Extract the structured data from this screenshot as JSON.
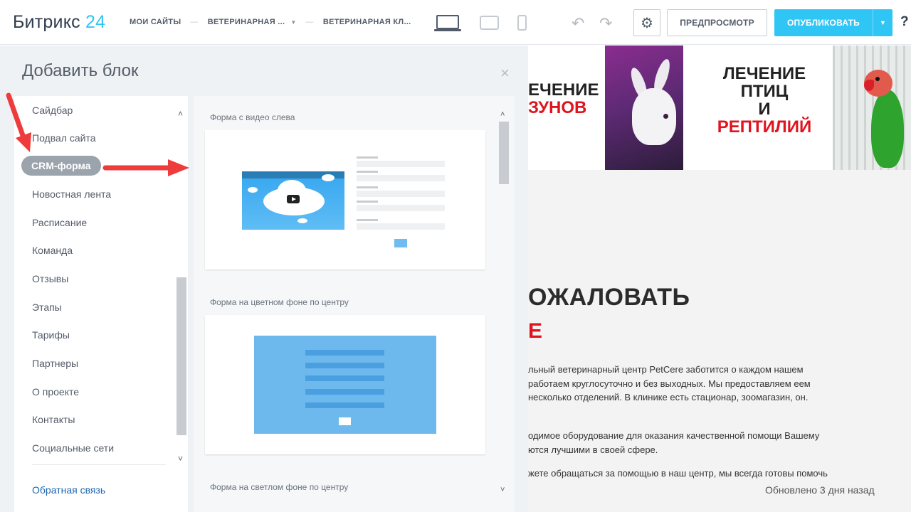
{
  "header": {
    "logo_main": "Битрикс",
    "logo_num": "24",
    "breadcrumbs": [
      "МОИ САЙТЫ",
      "ВЕТЕРИНАРНАЯ ...",
      "ВЕТЕРИНАРНАЯ КЛ..."
    ],
    "undo_icon": "↶",
    "redo_icon": "↷",
    "settings_icon": "⚙",
    "preview_label": "ПРЕДПРОСМОТР",
    "publish_label": "ОПУБЛИКОВАТЬ",
    "publish_caret": "▼",
    "help_label": "?"
  },
  "panel": {
    "title": "Добавить блок",
    "close_icon": "×",
    "menu": {
      "items": [
        "Сайдбар",
        "Подвал сайта",
        "CRM-форма",
        "Новостная лента",
        "Расписание",
        "Команда",
        "Отзывы",
        "Этапы",
        "Тарифы",
        "Партнеры",
        "О проекте",
        "Контакты",
        "Социальные сети"
      ],
      "active_index": 2,
      "feedback_link": "Обратная связь",
      "scroll_up": "˄",
      "scroll_down": "˅"
    },
    "blocks": [
      {
        "title": "Форма с видео слева"
      },
      {
        "title": "Форма на цветном фоне по центру"
      },
      {
        "title": "Форма на светлом фоне по центру"
      }
    ],
    "blocks_scroll_up": "˄",
    "blocks_scroll_down": "˅"
  },
  "site": {
    "banner_left_line1": "ЕЧЕНИЕ",
    "banner_left_line2": "ЗУНОВ",
    "banner_right_line1": "ЛЕЧЕНИЕ",
    "banner_right_line2": "ПТИЦ",
    "banner_right_line3": "И",
    "banner_right_line4": "РЕПТИЛИЙ",
    "welcome": "ОЖАЛОВАТЬ",
    "welcome_red": "Е",
    "p1": "льный ветеринарный центр PetCere заботится о каждом нашем работаем круглосуточно и без выходных. Мы предоставляем еем несколько отделений. В клинике есть стационар, зоомагазин, он.",
    "p2": "одимое оборудование для оказания качественной помощи Вашему ются лучшими в своей сфере.",
    "p3": "жете обращаться за помощью в наш центр, мы всегда готовы помочь",
    "updated": "Обновлено 3 дня назад"
  },
  "colors": {
    "accent": "#2fc6f6",
    "annotation_arrow": "#ee3b3b",
    "active_pill": "#9ba3ac",
    "link": "#2067b0"
  }
}
